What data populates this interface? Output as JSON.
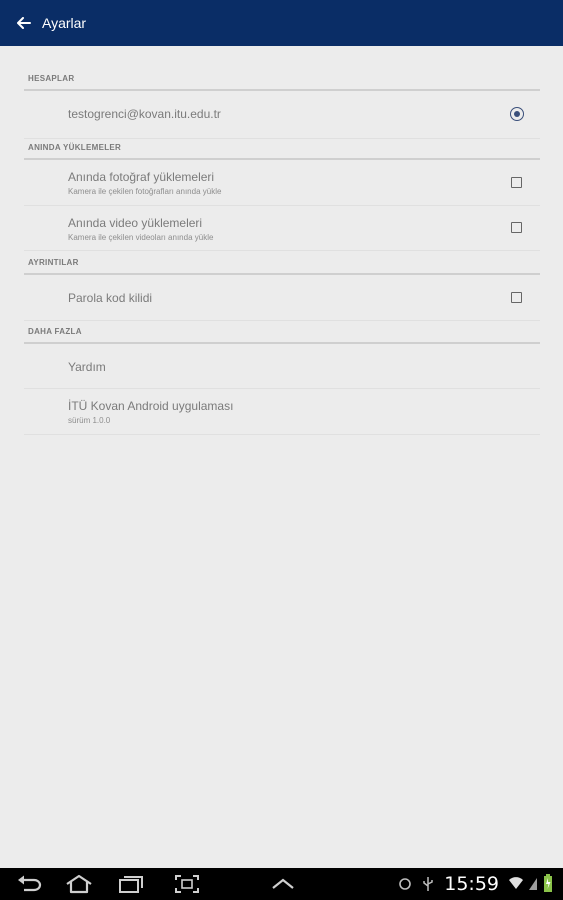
{
  "appbar": {
    "title": "Ayarlar"
  },
  "sections": {
    "accounts": {
      "header": "HESAPLAR",
      "account_email": "testogrenci@kovan.itu.edu.tr"
    },
    "instant_uploads": {
      "header": "ANINDA YÜKLEMELER",
      "photo_title": "Anında fotoğraf yüklemeleri",
      "photo_subtitle": "Kamera ile çekilen fotoğrafları anında yükle",
      "video_title": "Anında video yüklemeleri",
      "video_subtitle": "Kamera ile çekilen videoları anında yükle"
    },
    "details": {
      "header": "AYRINTILAR",
      "passcode_title": "Parola kod kilidi"
    },
    "more": {
      "header": "DAHA FAZLA",
      "help_title": "Yardım",
      "about_title": "İTÜ Kovan Android uygulaması",
      "about_subtitle": "sürüm 1.0.0"
    }
  },
  "states": {
    "account_selected": true,
    "photo_uploads": false,
    "video_uploads": false,
    "passcode_lock": false
  },
  "system_bar": {
    "time": "15:59"
  },
  "colors": {
    "appbar": "#0a2d66",
    "background": "#ececec",
    "navbar": "#000000"
  }
}
